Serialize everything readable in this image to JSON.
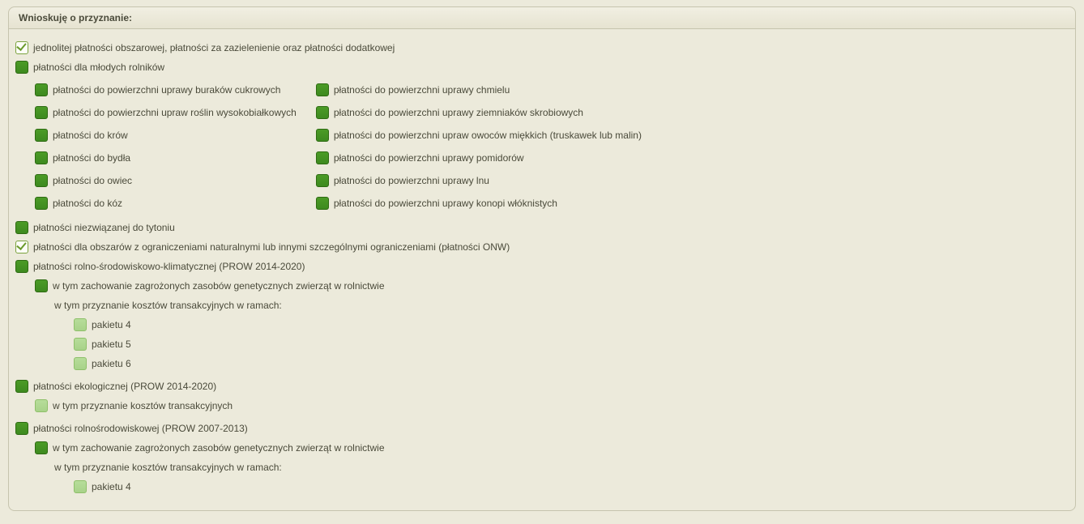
{
  "header": {
    "title": "Wnioskuję o przyznanie:"
  },
  "items": {
    "jedn": "jednolitej płatności obszarowej, płatności za zazielenienie oraz płatności dodatkowej",
    "mlodzi": "płatności dla młodych rolników",
    "grid": {
      "col1": [
        "płatności do powierzchni uprawy buraków cukrowych",
        "płatności do powierzchni upraw roślin wysokobiałkowych",
        "płatności do krów",
        "płatności do bydła",
        "płatności do owiec",
        "płatności do kóz"
      ],
      "col2": [
        "płatności do powierzchni uprawy chmielu",
        "płatności do powierzchni uprawy ziemniaków skrobiowych",
        "płatności do powierzchni upraw owoców miękkich (truskawek lub malin)",
        "płatności do powierzchni uprawy pomidorów",
        "płatności do powierzchni uprawy lnu",
        "płatności do powierzchni uprawy konopi włóknistych"
      ]
    },
    "tyton": "płatności niezwiązanej do tytoniu",
    "onw": "płatności dla obszarów z ograniczeniami naturalnymi lub innymi szczególnymi ograniczeniami (płatności ONW)",
    "rolno_klim": "płatności rolno-środowiskowo-klimatycznej (PROW 2014-2020)",
    "rolno_klim_sub": "w tym zachowanie zagrożonych zasobów genetycznych zwierząt w rolnictwie",
    "koszty_label": "w tym przyznanie kosztów transakcyjnych w ramach:",
    "pakiet4": "pakietu 4",
    "pakiet5": "pakietu 5",
    "pakiet6": "pakietu 6",
    "ekologiczna": "płatności ekologicznej (PROW 2014-2020)",
    "ekologiczna_sub": "w tym przyznanie kosztów transakcyjnych",
    "rolnosrod": "płatności rolnośrodowiskowej (PROW 2007-2013)",
    "rolnosrod_sub": "w tym zachowanie zagrożonych zasobów genetycznych zwierząt w rolnictwie",
    "rolnosrod_koszty": "w tym przyznanie kosztów transakcyjnych w ramach:",
    "rolnosrod_pakiet4": "pakietu 4"
  }
}
